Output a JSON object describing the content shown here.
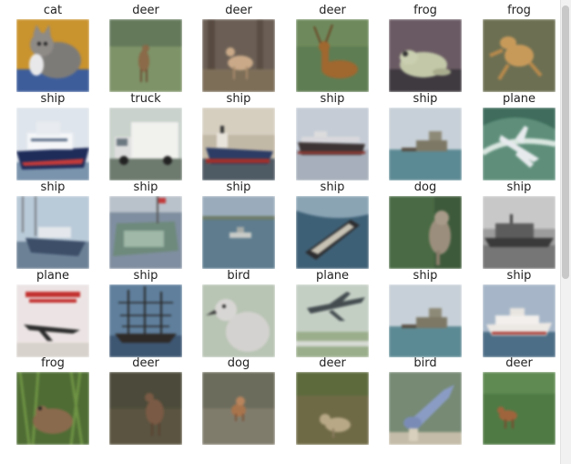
{
  "figure": {
    "rows": [
      [
        {
          "label": "cat",
          "art": "cat"
        },
        {
          "label": "deer",
          "art": "deer_grass"
        },
        {
          "label": "deer",
          "art": "deer_forest"
        },
        {
          "label": "deer",
          "art": "deer_stag"
        },
        {
          "label": "frog",
          "art": "frog_pale"
        },
        {
          "label": "frog",
          "art": "frog_olive"
        }
      ],
      [
        {
          "label": "ship",
          "art": "ship_ferry"
        },
        {
          "label": "truck",
          "art": "truck"
        },
        {
          "label": "ship",
          "art": "ship_tanker"
        },
        {
          "label": "ship",
          "art": "ship_grey"
        },
        {
          "label": "ship",
          "art": "ship_sea"
        },
        {
          "label": "plane",
          "art": "plane_wave"
        }
      ],
      [
        {
          "label": "ship",
          "art": "ship_marina"
        },
        {
          "label": "ship",
          "art": "ship_deck"
        },
        {
          "label": "ship",
          "art": "ship_small"
        },
        {
          "label": "ship",
          "art": "ship_aerial"
        },
        {
          "label": "dog",
          "art": "dog"
        },
        {
          "label": "ship",
          "art": "ship_bw"
        }
      ],
      [
        {
          "label": "plane",
          "art": "plane_poster"
        },
        {
          "label": "ship",
          "art": "ship_tall"
        },
        {
          "label": "bird",
          "art": "bird_dove"
        },
        {
          "label": "plane",
          "art": "plane_jet"
        },
        {
          "label": "ship",
          "art": "ship_sea"
        },
        {
          "label": "ship",
          "art": "ship_cruise"
        }
      ],
      [
        {
          "label": "frog",
          "art": "frog_grass"
        },
        {
          "label": "deer",
          "art": "deer_dark"
        },
        {
          "label": "dog",
          "art": "dog_small"
        },
        {
          "label": "deer",
          "art": "deer_field"
        },
        {
          "label": "bird",
          "art": "bird_blue"
        },
        {
          "label": "deer",
          "art": "deer_green"
        }
      ]
    ]
  }
}
